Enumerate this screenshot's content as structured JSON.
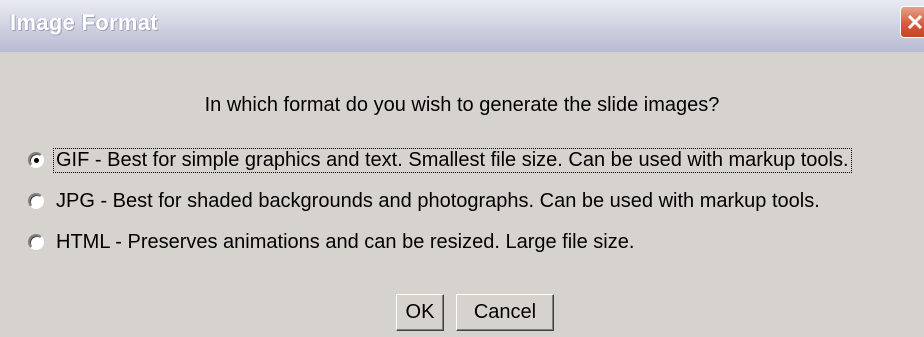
{
  "window": {
    "title": "Image Format",
    "close_icon": "close-icon"
  },
  "dialog": {
    "question": "In which format do you wish to generate the slide images?",
    "options": [
      {
        "label": "GIF - Best for simple graphics and text. Smallest file size. Can be used with markup tools.",
        "selected": true
      },
      {
        "label": "JPG - Best for shaded backgrounds and photographs. Can be used with markup tools.",
        "selected": false
      },
      {
        "label": "HTML - Preserves animations and can be resized. Large file size.",
        "selected": false
      }
    ]
  },
  "buttons": {
    "ok_label": "OK",
    "cancel_label": "Cancel"
  },
  "colors": {
    "dialog_background": "#d6d3ce",
    "close_button": "#d6573a"
  }
}
